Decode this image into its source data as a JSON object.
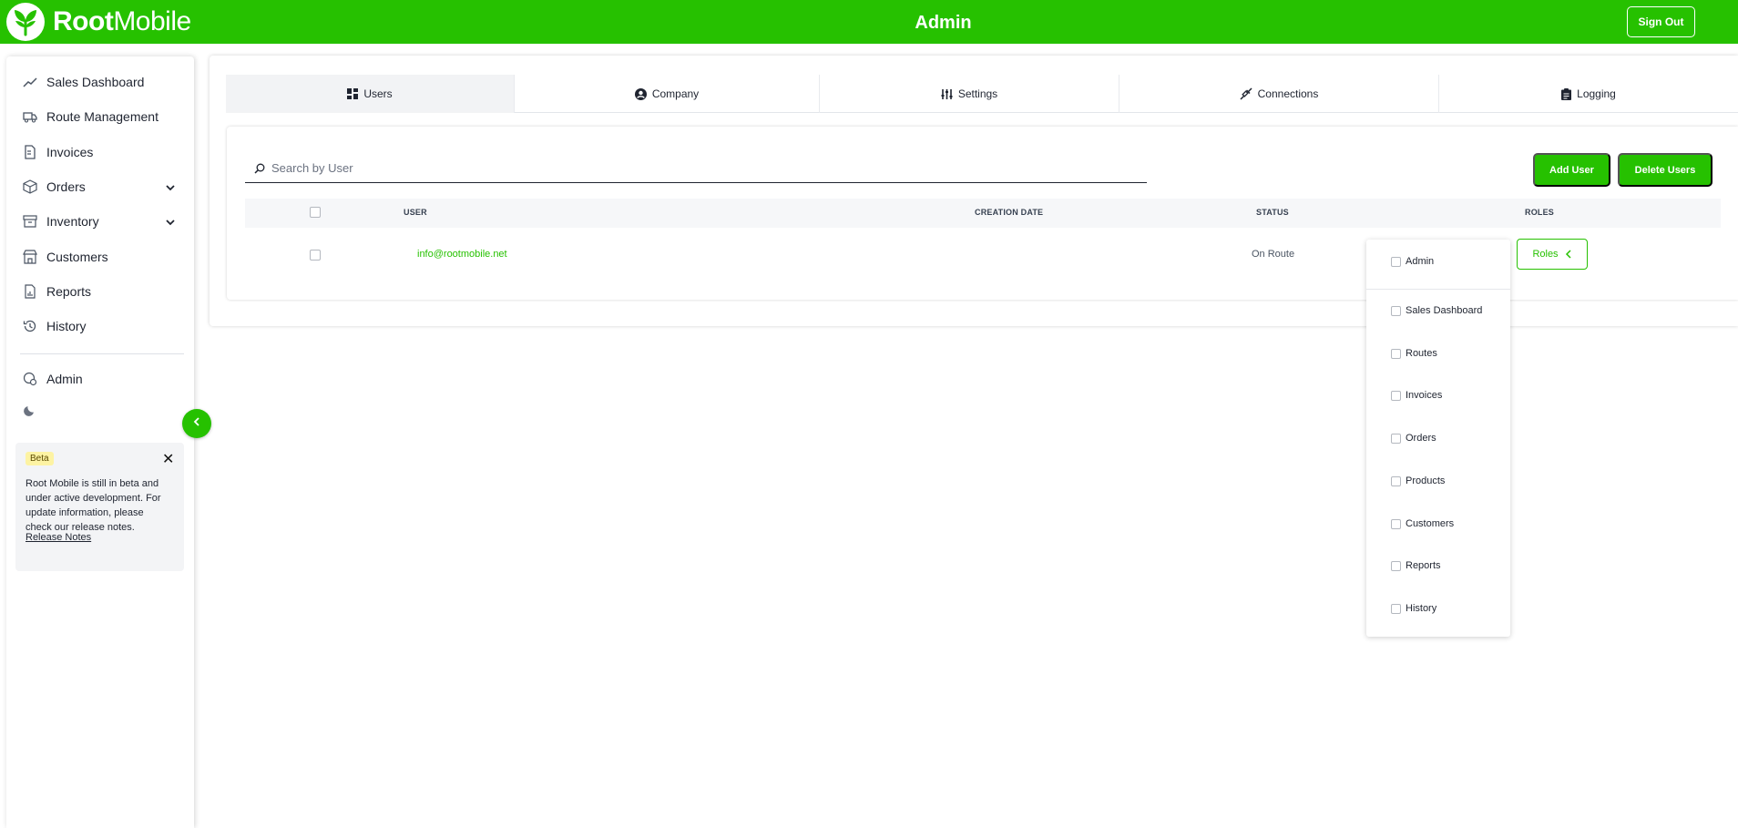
{
  "header": {
    "brand_bold": "Root",
    "brand_rest": "Mobile",
    "title": "Admin",
    "signout_label": "Sign Out",
    "color": "#26c100"
  },
  "sidebar": {
    "items": [
      {
        "label": "Sales Dashboard",
        "icon": "trend-line-icon"
      },
      {
        "label": "Route Management",
        "icon": "truck-icon"
      },
      {
        "label": "Invoices",
        "icon": "invoice-icon"
      },
      {
        "label": "Orders",
        "icon": "box-icon",
        "expandable": true
      },
      {
        "label": "Inventory",
        "icon": "archive-icon",
        "expandable": true
      },
      {
        "label": "Customers",
        "icon": "store-icon"
      },
      {
        "label": "Reports",
        "icon": "report-icon"
      },
      {
        "label": "History",
        "icon": "history-icon"
      }
    ],
    "admin_label": "Admin",
    "beta": {
      "badge": "Beta",
      "text": "Root Mobile is still in beta and under active development. For update information, please check our release notes.",
      "link": "Release Notes"
    }
  },
  "tabs": [
    {
      "label": "Users",
      "icon": "dashboard-grid-icon",
      "active": true
    },
    {
      "label": "Company",
      "icon": "user-circle-icon"
    },
    {
      "label": "Settings",
      "icon": "sliders-icon"
    },
    {
      "label": "Connections",
      "icon": "plug-icon"
    },
    {
      "label": "Logging",
      "icon": "clipboard-icon"
    }
  ],
  "users": {
    "search_placeholder": "Search by User",
    "add_label": "Add User",
    "delete_label": "Delete Users",
    "columns": [
      "USER",
      "CREATION DATE",
      "STATUS",
      "ROLES"
    ],
    "rows": [
      {
        "user": "info@rootmobile.net",
        "creation_date": "",
        "status": "On Route",
        "roles_label": "Roles"
      }
    ]
  },
  "roles_menu": {
    "items": [
      "Admin",
      "Sales Dashboard",
      "Routes",
      "Invoices",
      "Orders",
      "Products",
      "Customers",
      "Reports",
      "History"
    ]
  }
}
